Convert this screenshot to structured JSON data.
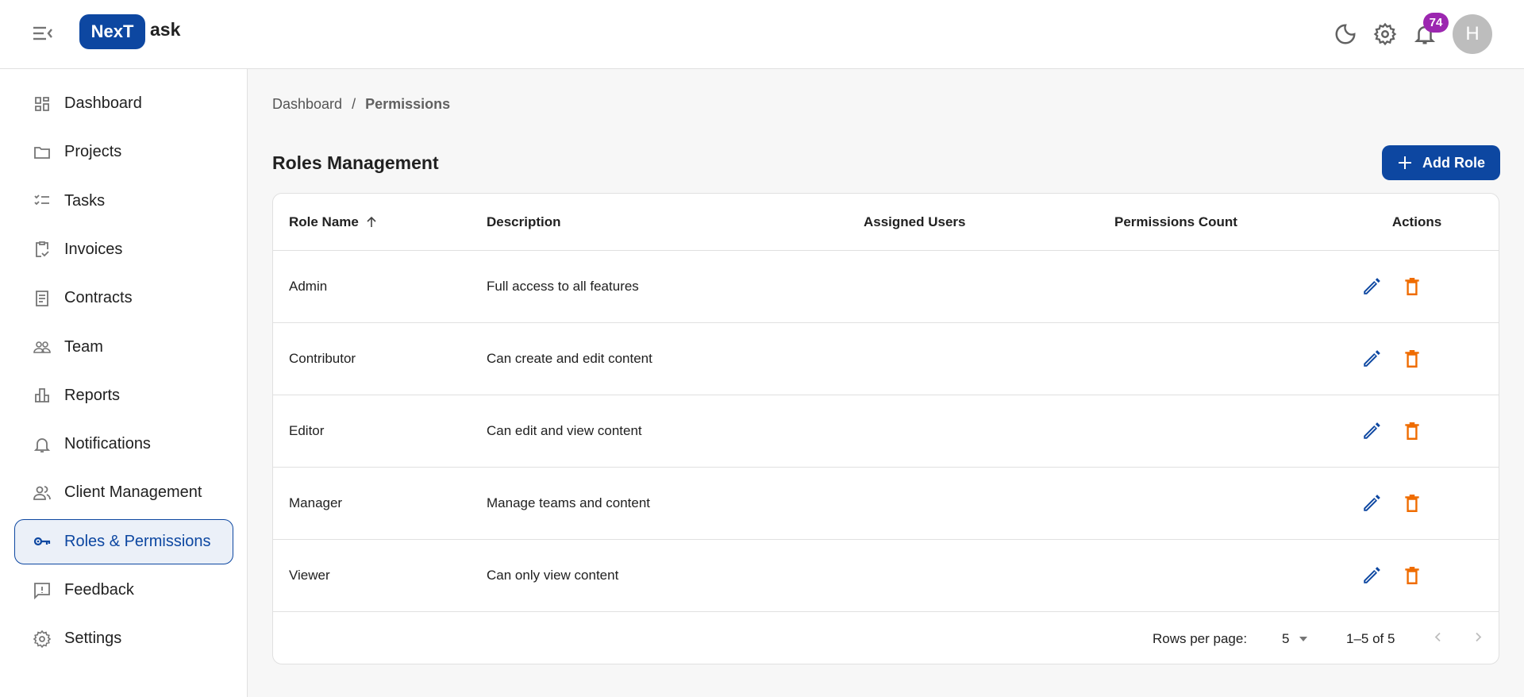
{
  "header": {
    "logo_box": "NexT",
    "logo_rest": "ask",
    "notification_count": "74",
    "avatar_initial": "H"
  },
  "sidebar": {
    "items": [
      {
        "label": "Dashboard",
        "icon": "dashboard-icon"
      },
      {
        "label": "Projects",
        "icon": "folder-icon"
      },
      {
        "label": "Tasks",
        "icon": "checklist-icon"
      },
      {
        "label": "Invoices",
        "icon": "clipboard-check-icon"
      },
      {
        "label": "Contracts",
        "icon": "document-icon"
      },
      {
        "label": "Team",
        "icon": "team-icon"
      },
      {
        "label": "Reports",
        "icon": "bar-chart-icon"
      },
      {
        "label": "Notifications",
        "icon": "bell-icon"
      },
      {
        "label": "Client Management",
        "icon": "people-icon"
      },
      {
        "label": "Roles & Permissions",
        "icon": "key-icon",
        "active": true
      },
      {
        "label": "Feedback",
        "icon": "feedback-icon"
      },
      {
        "label": "Settings",
        "icon": "gear-icon"
      }
    ]
  },
  "breadcrumb": {
    "parent": "Dashboard",
    "separator": "/",
    "current": "Permissions"
  },
  "page_title": "Roles Management",
  "add_button": "Add Role",
  "table": {
    "headers": [
      "Role Name",
      "Description",
      "Assigned Users",
      "Permissions Count",
      "Actions"
    ],
    "rows": [
      {
        "name": "Admin",
        "description": "Full access to all features",
        "users": "",
        "count": ""
      },
      {
        "name": "Contributor",
        "description": "Can create and edit content",
        "users": "",
        "count": ""
      },
      {
        "name": "Editor",
        "description": "Can edit and view content",
        "users": "",
        "count": ""
      },
      {
        "name": "Manager",
        "description": "Manage teams and content",
        "users": "",
        "count": ""
      },
      {
        "name": "Viewer",
        "description": "Can only view content",
        "users": "",
        "count": ""
      }
    ],
    "pagination": {
      "rows_per_page_label": "Rows per page:",
      "rows_per_page": "5",
      "range": "1–5 of 5"
    }
  },
  "colors": {
    "primary": "#0d47a1",
    "delete": "#ef6c00",
    "badge": "#9c27b0"
  }
}
